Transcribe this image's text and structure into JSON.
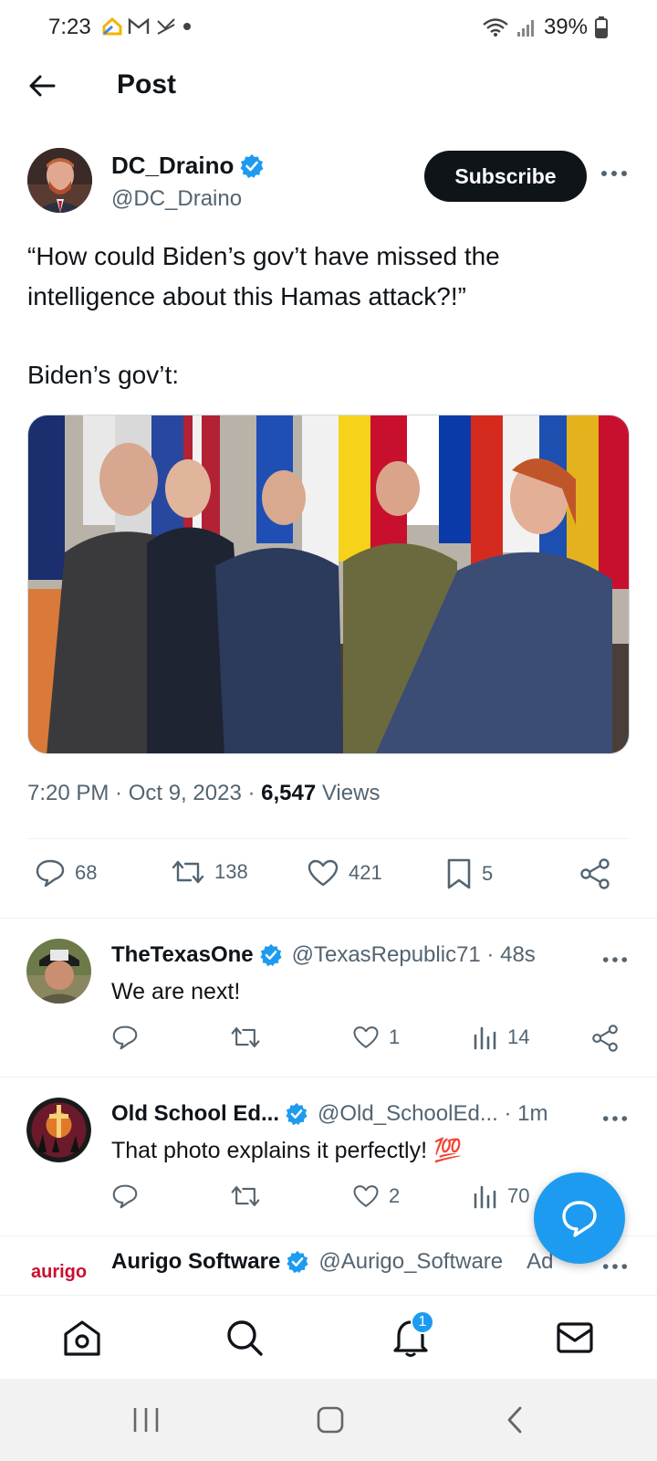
{
  "status_bar": {
    "time": "7:23",
    "battery": "39%"
  },
  "header": {
    "title": "Post"
  },
  "post": {
    "author_name": "DC_Draino",
    "author_handle": "@DC_Draino",
    "subscribe_label": "Subscribe",
    "text_line1": "“How could Biden’s gov’t have missed the intelligence about this Hamas attack?!”",
    "text_line2": "Biden’s gov’t:",
    "timestamp": "7:20 PM · Oct 9, 2023 · ",
    "views_count": "6,547",
    "views_label": " Views",
    "stats": {
      "replies": "68",
      "reposts": "138",
      "likes": "421",
      "bookmarks": "5"
    }
  },
  "replies": [
    {
      "name": "TheTexasOne",
      "handle": "@TexasRepublic71 · 48s",
      "text": "We are next!",
      "replies": "",
      "reposts": "",
      "likes": "1",
      "views": "14"
    },
    {
      "name": "Old School Ed...",
      "handle": "@Old_SchoolEd... · 1m",
      "text": "That photo explains it perfectly! 💯",
      "replies": "",
      "reposts": "",
      "likes": "2",
      "views": "70"
    },
    {
      "name": "Aurigo Software",
      "handle": "@Aurigo_Software",
      "ad_label": "Ad",
      "avatar_text": "aurigo"
    }
  ],
  "nav": {
    "notifications_badge": "1"
  },
  "colors": {
    "accent": "#1d9bf0",
    "text": "#0f1419",
    "muted": "#536471"
  }
}
